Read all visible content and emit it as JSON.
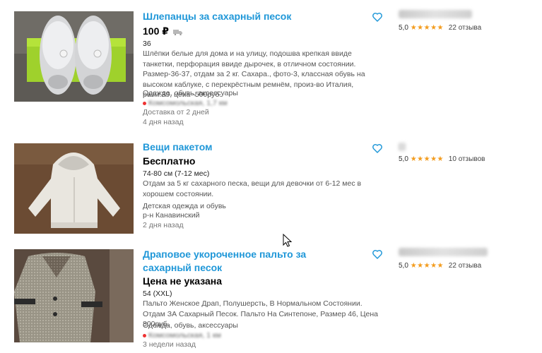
{
  "listings": [
    {
      "title": "Шлепанцы за сахарный песок",
      "price": "100 ₽",
      "param": "36",
      "description": "Шлёпки белые для дома и на улицу, подошва крепкая ввиде танкетки, перфорация ввиде дырочек, в отличном состоянии. Размер-36-37, отдам за 2 кг. Сахара., фото-3, классная обувь на высоком каблуке, с перекрёстным ремнём, произ-во Италия, разм.39, цена -500руб.",
      "category": "Одежда, обувь, аксессуары",
      "location": "Комсомольская, 1,7 км",
      "delivery": "Доставка от 2 дней",
      "posted": "4 дня назад",
      "rating": "5,0",
      "stars": "★★★★★",
      "reviews": "22 отзыва",
      "icons": {
        "favorite": "heart-outline-icon",
        "delivery": "truck-icon"
      }
    },
    {
      "title": "Вещи пакетом",
      "price": "Бесплатно",
      "param": "74-80 см (7-12 мес)",
      "description": "Отдам за 5 кг сахарного песка, вещи для девочки от 6-12 мес в хорошем состоянии.",
      "category": "Детская одежда и обувь",
      "location": "р-н Канавинский",
      "posted": "2 дня назад",
      "rating": "5,0",
      "stars": "★★★★★",
      "reviews": "10 отзывов",
      "icons": {
        "favorite": "heart-outline-icon"
      }
    },
    {
      "title": "Драповое укороченное пальто за сахарный песок",
      "price": "Цена не указана",
      "param": "54 (XXL)",
      "description": "Пальто Женское Драп, Полушерсть, В Нормальном Состоянии. Отдам ЗА Сахарный Песок. Пальто На Синтепоне, Размер 46, Цена 800руб.",
      "category": "Одежда, обувь, аксессуары",
      "location": "Комсомольская, 1 км",
      "posted": "3 недели назад",
      "rating": "5,0",
      "stars": "★★★★★",
      "reviews": "22 отзыва",
      "icons": {
        "favorite": "heart-outline-icon"
      }
    }
  ],
  "colors": {
    "link": "#1f97d8",
    "star": "#f39c1e",
    "metro_dot": "#e33333"
  }
}
